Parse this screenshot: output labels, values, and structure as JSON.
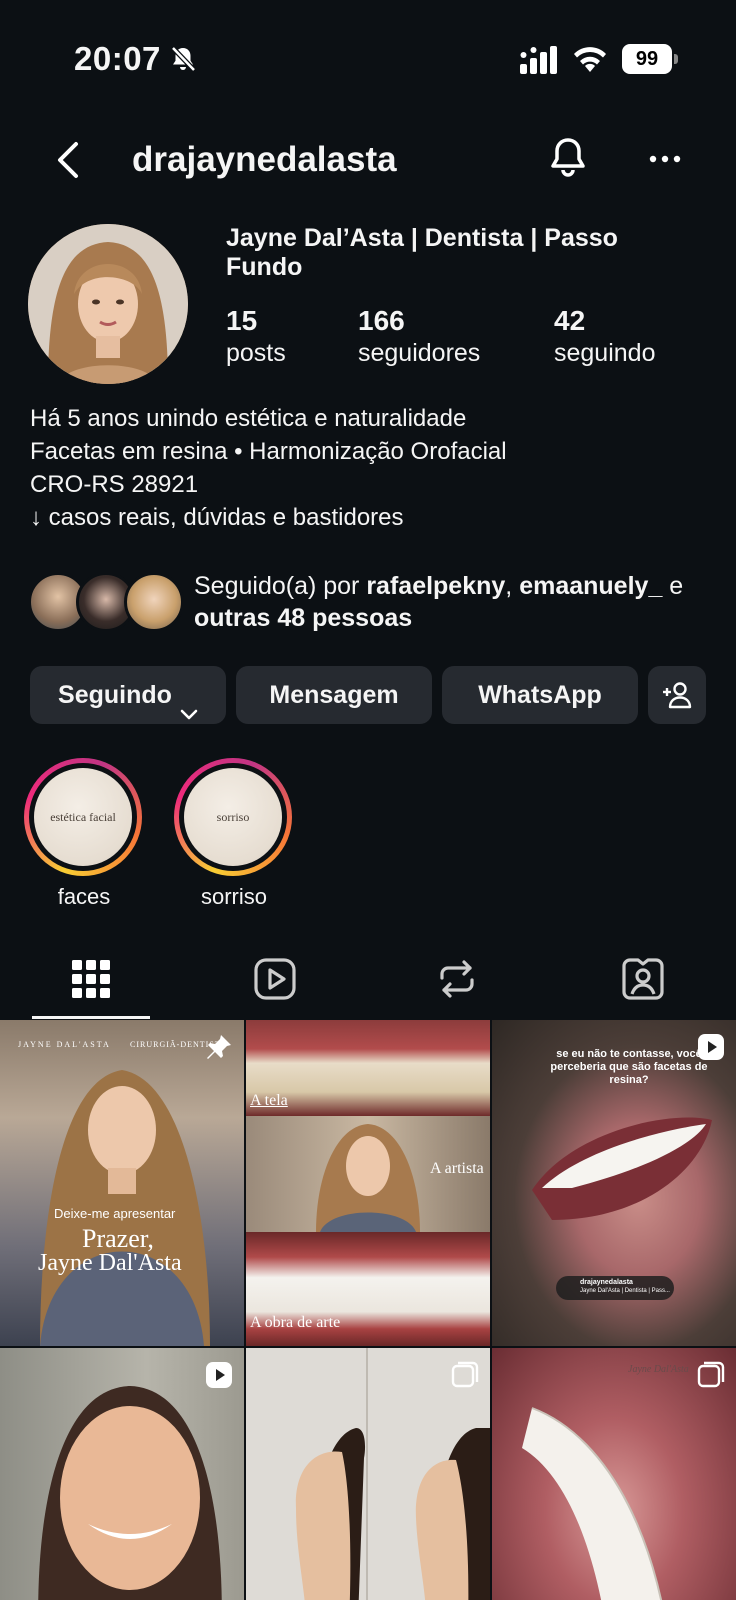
{
  "status_bar": {
    "time": "20:07",
    "battery": "99",
    "icons": [
      "bell-off-icon",
      "signal-icon",
      "wifi-icon",
      "battery-icon"
    ]
  },
  "header": {
    "username": "drajaynedalasta",
    "icons": [
      "back-icon",
      "bell-icon",
      "more-icon"
    ]
  },
  "profile": {
    "display_name": "Jayne Dal’Asta | Dentista | Passo Fundo",
    "stats": [
      {
        "num": "15",
        "label": "posts"
      },
      {
        "num": "166",
        "label": "seguidores"
      },
      {
        "num": "42",
        "label": "seguindo"
      }
    ],
    "bio": [
      "Há 5 anos unindo estética e naturalidade",
      "Facetas em resina • Harmonização Orofacial",
      "CRO-RS 28921",
      "↓ casos reais, dúvidas e bastidores"
    ]
  },
  "followed_by": {
    "prefix": "Seguido(a) por ",
    "user1": "rafaelpekny",
    "sep": ", ",
    "user2": "emaanuely_",
    "and": " e",
    "others": "outras 48 pessoas"
  },
  "buttons": {
    "following": "Seguindo",
    "message": "Mensagem",
    "whatsapp": "WhatsApp"
  },
  "highlights": [
    {
      "label": "faces",
      "cover_text": "estética facial"
    },
    {
      "label": "sorriso",
      "cover_text": "sorriso"
    }
  ],
  "grid_posts": [
    {
      "header_left": "JAYNE DAL'ASTA",
      "header_right": "CIRURGIÃ-DENTISTA",
      "line1": "Deixe-me apresentar",
      "line2": "Prazer,",
      "line3": "Jayne Dal'Asta",
      "badge": "pin-icon"
    },
    {
      "label_top": "A tela",
      "label_mid": "A artista",
      "label_bottom": "A obra de arte"
    },
    {
      "caption": "se eu não te contasse, você perceberia que são facetas de resina?",
      "mini_user": "drajaynedalasta",
      "mini_sub": "Jayne Dal'Asta | Dentista | Pass...",
      "badge": "reel-icon"
    },
    {
      "badge": "reel-icon"
    },
    {
      "badge": "carousel-icon"
    },
    {
      "signature": "Jayne Dal'Asta",
      "badge": "carousel-icon"
    }
  ]
}
